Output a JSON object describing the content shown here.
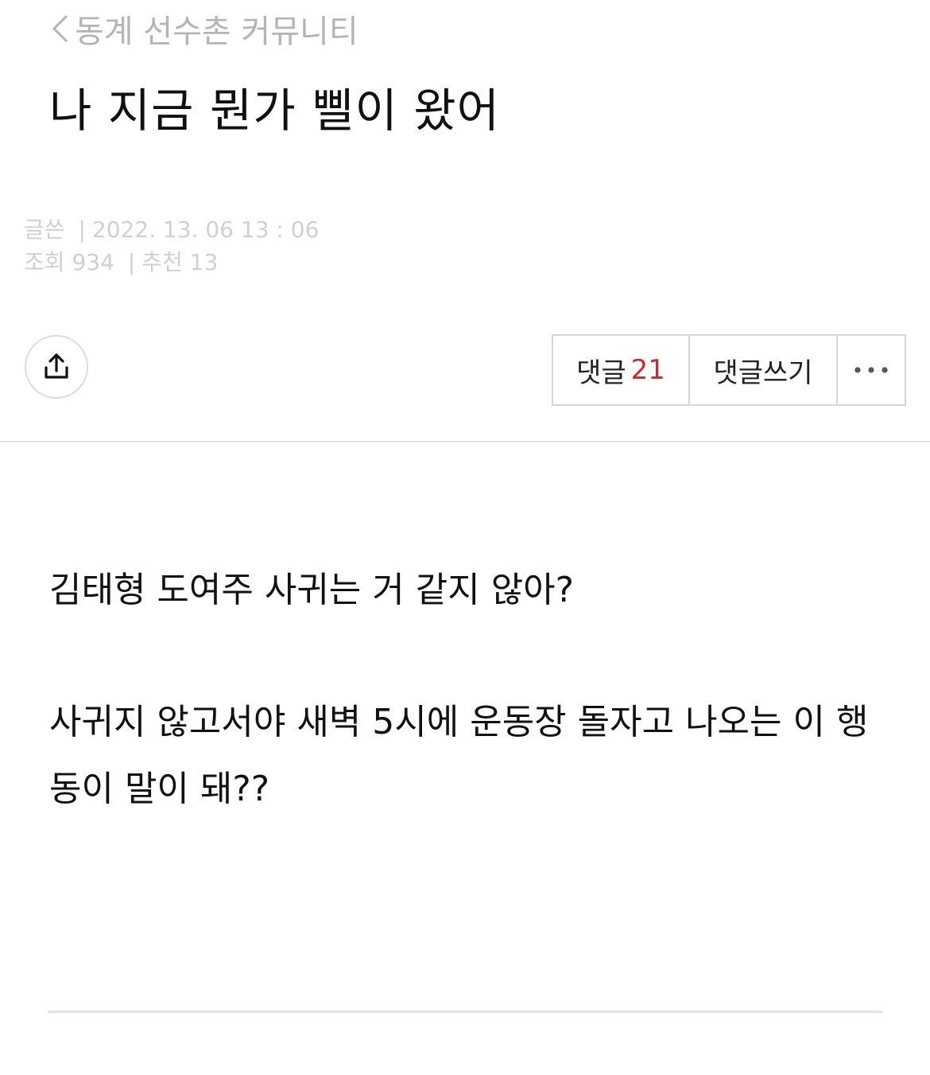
{
  "header": {
    "back_label": "동계 선수촌 커뮤니티",
    "back_icon": "chevron-left-icon"
  },
  "post": {
    "title": "나 지금 뭔가 삘이 왔어",
    "meta": {
      "author_label": "글쓴",
      "datetime": "2022. 13. 06 13 : 06",
      "views_label": "조회",
      "views": "934",
      "recommend_label": "추천",
      "recommend": "13"
    },
    "body": {
      "paragraph1": "김태형 도여주 사귀는 거 같지 않아?",
      "paragraph2": "사귀지 않고서야 새벽 5시에 운동장 돌자고 나오는 이 행동이 말이 돼??"
    }
  },
  "actions": {
    "share_icon": "share-upload-icon",
    "comments_label": "댓글",
    "comments_count": "21",
    "write_comment_label": "댓글쓰기",
    "more_icon": "more-dots-icon"
  },
  "colors": {
    "accent_count": "#d2262d",
    "muted_text": "#b4b4b4",
    "meta_text": "#d0d0d0",
    "border": "#d6d6d6"
  }
}
